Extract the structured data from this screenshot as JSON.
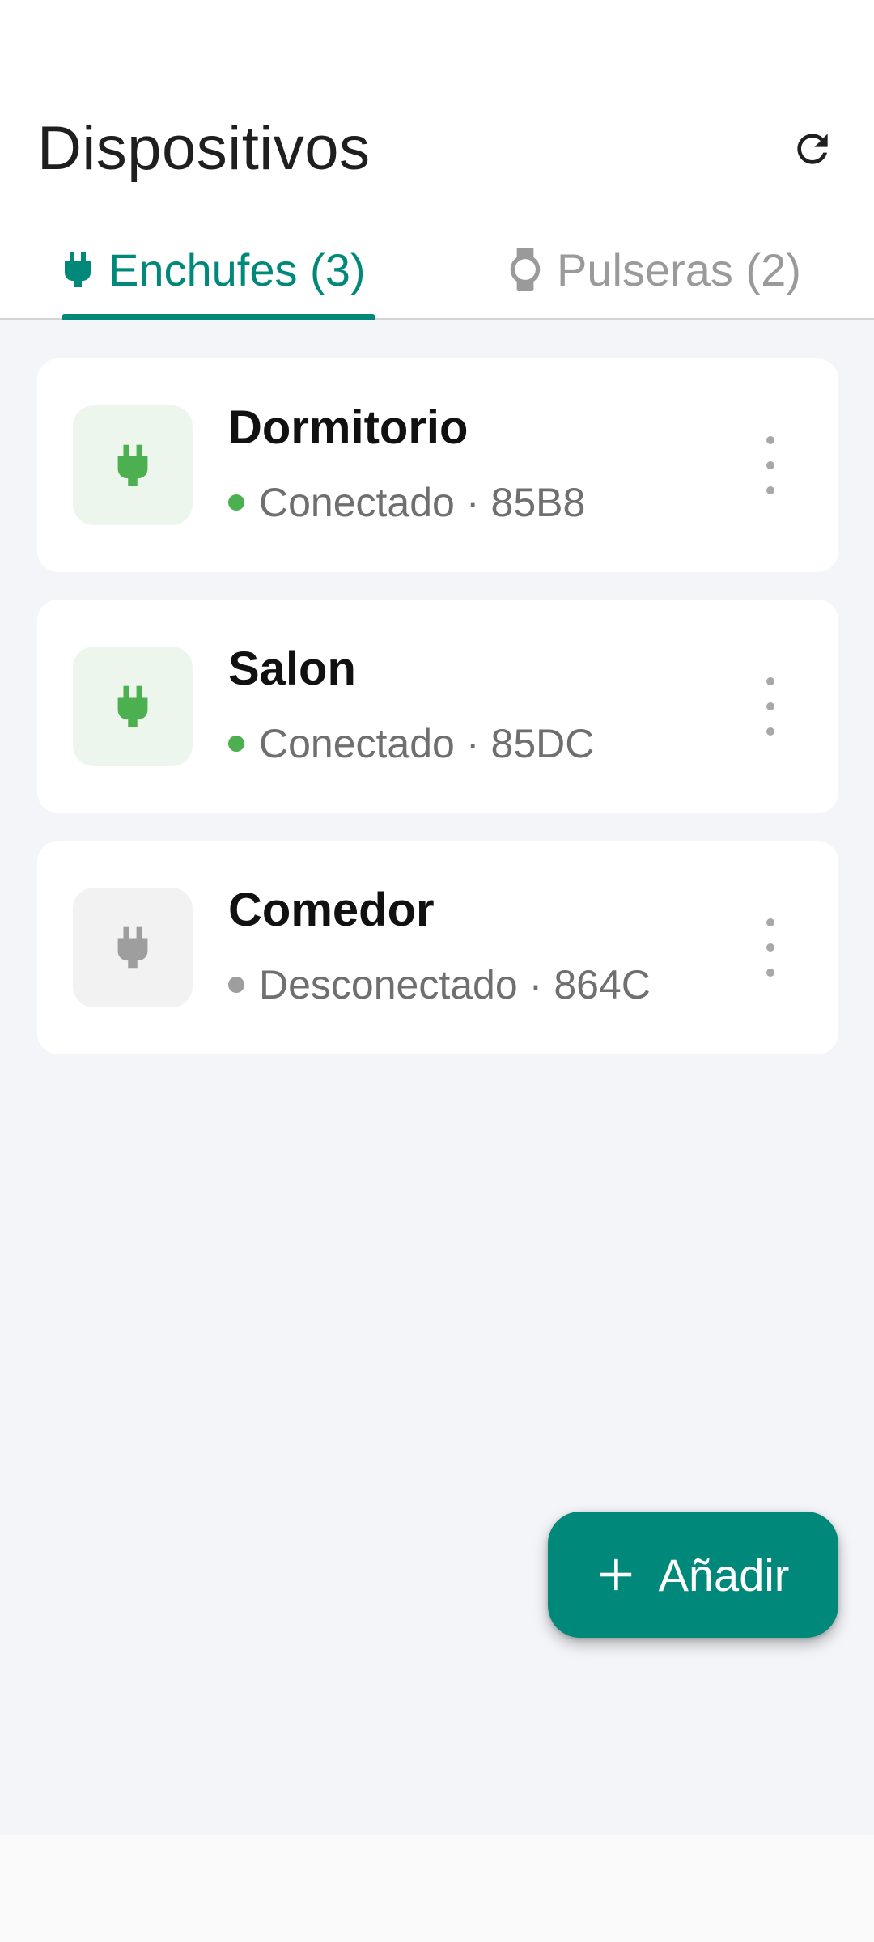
{
  "header": {
    "title": "Dispositivos",
    "refresh_icon": "refresh-icon"
  },
  "tabs": [
    {
      "label": "Enchufes (3)",
      "icon": "plug-icon",
      "active": true
    },
    {
      "label": "Pulseras (2)",
      "icon": "watch-icon",
      "active": false
    }
  ],
  "devices": [
    {
      "name": "Dormitorio",
      "status": "Conectado",
      "code": "85B8",
      "online": true
    },
    {
      "name": "Salon",
      "status": "Conectado",
      "code": "85DC",
      "online": true
    },
    {
      "name": "Comedor",
      "status": "Desconectado",
      "code": "864C",
      "online": false
    }
  ],
  "fab": {
    "label": "Añadir",
    "icon": "plus-icon"
  },
  "colors": {
    "accent": "#00897b",
    "online": "#4caf50",
    "offline": "#9e9e9e",
    "background": "#f4f5f9"
  }
}
